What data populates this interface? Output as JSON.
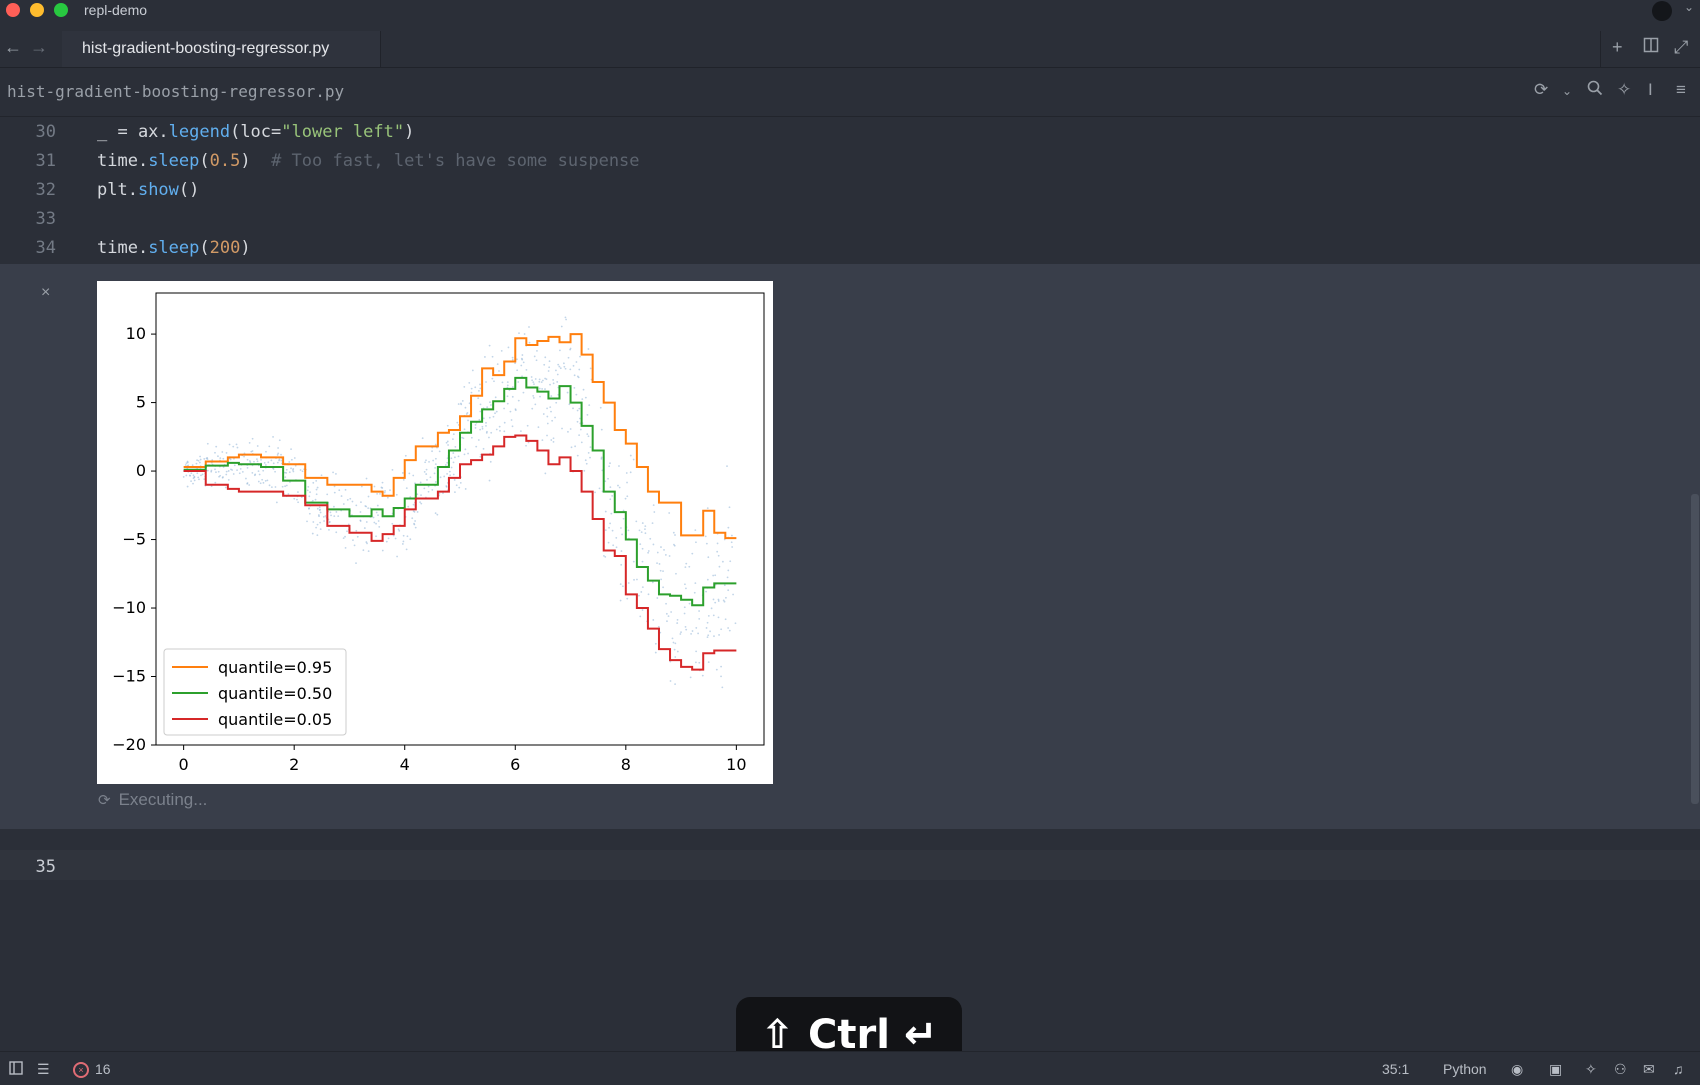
{
  "window": {
    "title": "repl-demo"
  },
  "tabs": [
    {
      "label": "hist-gradient-boosting-regressor.py",
      "active": true
    }
  ],
  "breadcrumb": {
    "file": "hist-gradient-boosting-regressor.py"
  },
  "editor": {
    "lines": [
      {
        "number": "30",
        "code": "_ = ax.legend(loc=\"lower left\")"
      },
      {
        "number": "31",
        "code": "time.sleep(0.5)  # Too fast, let's have some suspense"
      },
      {
        "number": "32",
        "code": "plt.show()"
      },
      {
        "number": "33",
        "code": ""
      },
      {
        "number": "34",
        "code": "time.sleep(200)"
      }
    ],
    "next_line_number": "35"
  },
  "output": {
    "close_glyph": "×",
    "status": "Executing...",
    "status_icon": "refresh-icon"
  },
  "chart_data": {
    "type": "line",
    "title": "",
    "xlabel": "",
    "ylabel": "",
    "xlim": [
      -0.5,
      10.5
    ],
    "ylim": [
      -20,
      13
    ],
    "xticks": [
      "0",
      "2",
      "4",
      "6",
      "8",
      "10"
    ],
    "yticks": [
      "10",
      "5",
      "0",
      "−5",
      "−10",
      "−15",
      "−20"
    ],
    "grid": false,
    "legend_position": "lower left",
    "series": [
      {
        "name": "quantile=0.95",
        "color": "#ff7f0e",
        "x": [
          0,
          0.4,
          0.8,
          1.0,
          1.4,
          1.8,
          2.2,
          2.6,
          3.0,
          3.4,
          3.6,
          3.8,
          4.0,
          4.2,
          4.6,
          4.8,
          5.0,
          5.2,
          5.4,
          5.6,
          5.8,
          6.0,
          6.2,
          6.4,
          6.6,
          6.8,
          7.0,
          7.2,
          7.4,
          7.6,
          7.8,
          8.0,
          8.2,
          8.4,
          8.6,
          8.8,
          9.0,
          9.2,
          9.4,
          9.6,
          9.8,
          10.0
        ],
        "y": [
          0.3,
          0.7,
          1.0,
          1.2,
          1.0,
          0.5,
          -0.5,
          -1.0,
          -1.0,
          -1.5,
          -1.8,
          -0.5,
          0.8,
          1.8,
          2.8,
          3.0,
          4.0,
          5.5,
          7.5,
          7.0,
          8.0,
          9.7,
          9.2,
          9.5,
          9.8,
          9.4,
          10.0,
          8.5,
          6.5,
          5.0,
          3.0,
          2.0,
          0.3,
          -1.5,
          -2.3,
          -2.3,
          -4.7,
          -4.7,
          -2.9,
          -4.5,
          -4.9,
          -4.9
        ]
      },
      {
        "name": "quantile=0.50",
        "color": "#2ca02c",
        "x": [
          0,
          0.4,
          0.8,
          1.0,
          1.4,
          1.8,
          2.2,
          2.6,
          3.0,
          3.4,
          3.6,
          3.8,
          4.0,
          4.2,
          4.6,
          4.8,
          5.0,
          5.2,
          5.4,
          5.6,
          5.8,
          6.0,
          6.2,
          6.4,
          6.6,
          6.8,
          7.0,
          7.2,
          7.4,
          7.6,
          7.8,
          8.0,
          8.2,
          8.4,
          8.6,
          8.8,
          9.0,
          9.2,
          9.4,
          9.6,
          9.8,
          10.0
        ],
        "y": [
          0.1,
          0.4,
          0.6,
          0.5,
          0.3,
          -0.7,
          -2.3,
          -2.8,
          -3.3,
          -2.8,
          -3.3,
          -2.7,
          -2.0,
          -1.0,
          0.3,
          1.5,
          2.8,
          3.6,
          4.5,
          5.1,
          6.0,
          6.8,
          6.1,
          5.8,
          5.3,
          6.2,
          5.0,
          3.3,
          1.5,
          -1.5,
          -3.0,
          -5.0,
          -7.0,
          -8.0,
          -9.0,
          -9.1,
          -9.4,
          -9.8,
          -8.5,
          -8.2,
          -8.2,
          -8.2
        ]
      },
      {
        "name": "quantile=0.05",
        "color": "#d62728",
        "x": [
          0,
          0.4,
          0.8,
          1.0,
          1.4,
          1.8,
          2.2,
          2.6,
          3.0,
          3.4,
          3.6,
          3.8,
          4.0,
          4.2,
          4.6,
          4.8,
          5.0,
          5.2,
          5.4,
          5.6,
          5.8,
          6.0,
          6.2,
          6.4,
          6.6,
          6.8,
          7.0,
          7.2,
          7.4,
          7.6,
          7.8,
          8.0,
          8.2,
          8.4,
          8.6,
          8.8,
          9.0,
          9.2,
          9.4,
          9.6,
          9.8,
          10.0
        ],
        "y": [
          0.0,
          -1.0,
          -1.3,
          -1.5,
          -1.5,
          -1.8,
          -2.5,
          -4.0,
          -4.5,
          -5.1,
          -4.6,
          -4.0,
          -2.8,
          -2.0,
          -1.5,
          -0.5,
          0.5,
          0.8,
          1.2,
          1.8,
          2.5,
          2.6,
          2.2,
          1.5,
          0.5,
          1.0,
          0.0,
          -1.5,
          -3.5,
          -5.8,
          -6.2,
          -9.0,
          -10.0,
          -11.5,
          -13.0,
          -13.8,
          -14.3,
          -14.5,
          -13.3,
          -13.1,
          -13.1,
          -13.1
        ]
      }
    ]
  },
  "keycap": {
    "text": "⇧ Ctrl ↵"
  },
  "statusbar": {
    "error_count": "16",
    "cursor_position": "35:1",
    "language": "Python"
  }
}
